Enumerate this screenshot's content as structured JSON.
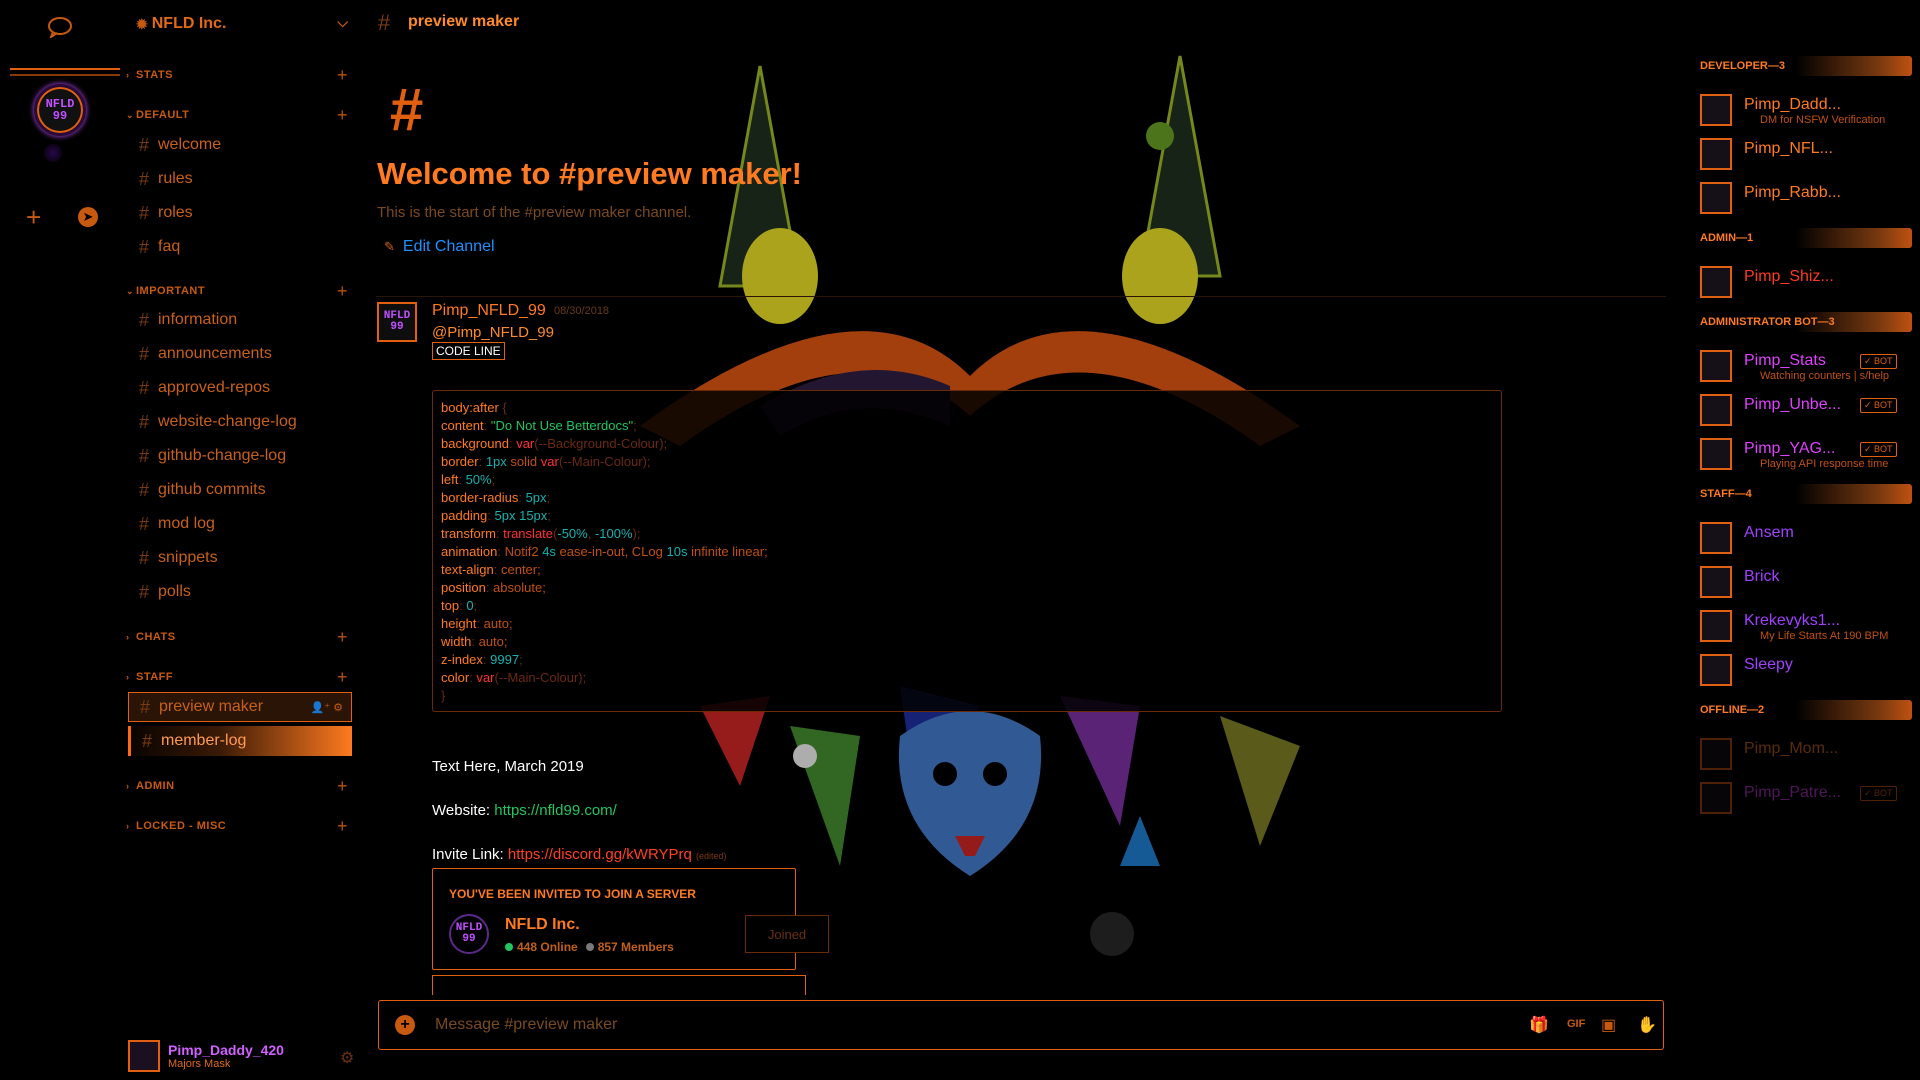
{
  "server": {
    "name": "NFLD Inc.",
    "icon_text_line1": "NFLD",
    "icon_text_line2": "99"
  },
  "categories": {
    "stats": "STATS",
    "default": "DEFAULT",
    "important": "IMPORTANT",
    "chats": "CHATS",
    "staff": "STAFF",
    "admin": "ADMIN",
    "locked_misc": "LOCKED - MISC"
  },
  "channels": {
    "default": [
      "welcome",
      "rules",
      "roles",
      "faq"
    ],
    "important": [
      "information",
      "announcements",
      "approved-repos",
      "website-change-log",
      "github-change-log",
      "github commits",
      "mod log",
      "snippets",
      "polls"
    ],
    "staff": [
      "preview maker",
      "member-log"
    ]
  },
  "current_user": {
    "name": "Pimp_Daddy_420",
    "status": "Majors Mask"
  },
  "topbar": {
    "channel": "preview maker"
  },
  "welcome": {
    "hash": "#",
    "title": "Welcome to #preview maker!",
    "subtitle": "This is the start of the #preview maker channel.",
    "edit": "Edit Channel"
  },
  "message": {
    "author": "Pimp_NFLD_99",
    "date": "08/30/2018",
    "mention": "@Pimp_NFLD_99",
    "code_label": "CODE LINE",
    "text_line": "Text Here, March 2019",
    "website_label": "Website:",
    "website_url": "https://nfld99.com/",
    "invite_label": "Invite Link:",
    "invite_url": "https://discord.gg/kWRYPrq",
    "edited": "(edited)"
  },
  "code": {
    "l1_sel": "body:after",
    "l1_brace": " {",
    "l2_prop": "content",
    "l2_val": "\"Do Not Use Betterdocs\"",
    "l3_prop": "background",
    "l3_fn": "var",
    "l3_arg": "(--Background-Colour);",
    "l4_prop": "border",
    "l4_num": "1px",
    "l4_kw": " solid ",
    "l4_fn": "var",
    "l4_arg": "(--Main-Colour);",
    "l5_prop": "left",
    "l5_num": "50%",
    "l6_prop": "border-radius",
    "l6_num": "5px",
    "l7_prop": "padding",
    "l7_num": "5px 15px",
    "l8_prop": "transform",
    "l8_fn": "translate",
    "l8_arg1": "(",
    "l8_n1": "-50%",
    "l8_c": ", ",
    "l8_n2": "-100%",
    "l8_arg2": ");",
    "l9_prop": "animation",
    "l9_w1": "Notif2 ",
    "l9_n1": "4s",
    "l9_w2": " ease-in-out, CLog ",
    "l9_n2": "10s",
    "l9_w3": " infinite linear;",
    "l10_prop": "text-align",
    "l10_val": "center;",
    "l11_prop": "position",
    "l11_val": "absolute;",
    "l12_prop": "top",
    "l12_num": "0",
    "l13_prop": "height",
    "l13_val": "auto;",
    "l14_prop": "width",
    "l14_val": "auto;",
    "l15_prop": "z-index",
    "l15_num": "9997",
    "l16_prop": "color",
    "l16_fn": "var",
    "l16_arg": "(--Main-Colour);",
    "l17": "}"
  },
  "invite": {
    "header": "YOU'VE BEEN INVITED TO JOIN A SERVER",
    "server": "NFLD Inc.",
    "online": "448 Online",
    "members": "857 Members",
    "button": "Joined"
  },
  "composer": {
    "placeholder": "Message #preview maker"
  },
  "member_groups": [
    {
      "title": "DEVELOPER—3",
      "members": [
        {
          "name": "Pimp_Dadd...",
          "sub": "DM for NSFW Verification",
          "color": "#ff7a20"
        },
        {
          "name": "Pimp_NFL...",
          "sub": "",
          "color": "#ff7a20"
        },
        {
          "name": "Pimp_Rabb...",
          "sub": "",
          "color": "#ff7a20"
        }
      ]
    },
    {
      "title": "ADMIN—1",
      "members": [
        {
          "name": "Pimp_Shiz...",
          "sub": "",
          "color": "#ff3a20"
        }
      ]
    },
    {
      "title": "ADMINISTRATOR BOT—3",
      "members": [
        {
          "name": "Pimp_Stats",
          "sub": "Watching counters | s/help",
          "color": "#e040ff",
          "bot": "✓ BOT"
        },
        {
          "name": "Pimp_Unbe...",
          "sub": "",
          "color": "#e040ff",
          "bot": "✓ BOT"
        },
        {
          "name": "Pimp_YAG...",
          "sub": "Playing API response time",
          "color": "#e040ff",
          "bot": "✓ BOT"
        }
      ]
    },
    {
      "title": "STAFF—4",
      "members": [
        {
          "name": "Ansem",
          "sub": "",
          "color": "#a040ff"
        },
        {
          "name": "Brick",
          "sub": "",
          "color": "#a040ff"
        },
        {
          "name": "Krekevyks1...",
          "sub": "My Life Starts At 190 BPM",
          "color": "#a040ff"
        },
        {
          "name": "Sleepy",
          "sub": "",
          "color": "#a040ff"
        }
      ]
    },
    {
      "title": "OFFLINE—2",
      "members": [
        {
          "name": "Pimp_Mom...",
          "sub": "",
          "color": "#ff7a20"
        },
        {
          "name": "Pimp_Patre...",
          "sub": "",
          "color": "#e040ff",
          "bot": "✓ BOT"
        }
      ]
    }
  ],
  "colors": {
    "accent": "#e06010",
    "link": "#1e90ff",
    "online": "#22c55e"
  }
}
